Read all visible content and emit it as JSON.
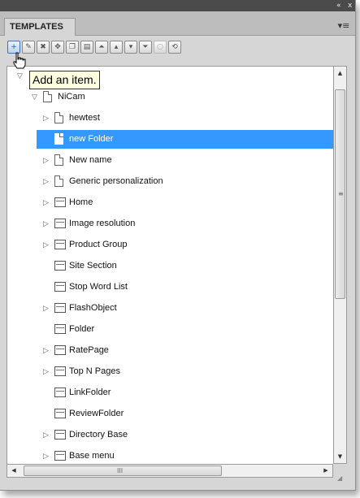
{
  "panel": {
    "tab_label": "TEMPLATES",
    "collapse_glyph": "«",
    "close_glyph": "x",
    "menu_glyph": "▾≡"
  },
  "toolbar": {
    "buttons": [
      {
        "name": "add-item-button",
        "icon": "add-icon",
        "glyph": "+"
      },
      {
        "name": "edit-item-button",
        "icon": "edit-icon",
        "glyph": "✎"
      },
      {
        "name": "delete-item-button",
        "icon": "delete-icon",
        "glyph": "✖"
      },
      {
        "name": "move-item-button",
        "icon": "move-icon",
        "glyph": "✥"
      },
      {
        "name": "copy-item-button",
        "icon": "copy-icon",
        "glyph": "❐"
      },
      {
        "name": "paste-item-button",
        "icon": "paste-icon",
        "glyph": "▤"
      },
      {
        "name": "move-top-button",
        "icon": "double-up-icon",
        "glyph": "⏶"
      },
      {
        "name": "move-up-button",
        "icon": "up-icon",
        "glyph": "▴"
      },
      {
        "name": "move-down-button",
        "icon": "down-icon",
        "glyph": "▾"
      },
      {
        "name": "move-bottom-button",
        "icon": "double-down-icon",
        "glyph": "⏷"
      },
      {
        "name": "disabled-button",
        "icon": "circle-icon",
        "glyph": "○"
      },
      {
        "name": "refresh-button",
        "icon": "refresh-icon",
        "glyph": "⟲"
      }
    ]
  },
  "tooltip": {
    "text": "Add an item."
  },
  "tree": {
    "items": [
      {
        "label": "NiCam",
        "expander": "expanded",
        "icon": "document-icon"
      },
      {
        "label": "hewtest",
        "expander": "collapsed",
        "icon": "document-icon"
      },
      {
        "label": "new Folder",
        "expander": "none",
        "icon": "document-icon",
        "selected": true
      },
      {
        "label": "New name",
        "expander": "collapsed",
        "icon": "document-icon"
      },
      {
        "label": "Generic personalization",
        "expander": "collapsed",
        "icon": "document-icon"
      },
      {
        "label": "Home",
        "expander": "collapsed",
        "icon": "template-icon"
      },
      {
        "label": "Image resolution",
        "expander": "collapsed",
        "icon": "template-icon"
      },
      {
        "label": "Product Group",
        "expander": "collapsed",
        "icon": "template-icon"
      },
      {
        "label": "Site Section",
        "expander": "none",
        "icon": "template-icon"
      },
      {
        "label": "Stop Word List",
        "expander": "none",
        "icon": "template-icon"
      },
      {
        "label": "FlashObject",
        "expander": "collapsed",
        "icon": "template-icon"
      },
      {
        "label": "Folder",
        "expander": "none",
        "icon": "template-icon"
      },
      {
        "label": "RatePage",
        "expander": "collapsed",
        "icon": "template-icon"
      },
      {
        "label": "Top N Pages",
        "expander": "collapsed",
        "icon": "template-icon"
      },
      {
        "label": "LinkFolder",
        "expander": "none",
        "icon": "template-icon"
      },
      {
        "label": "ReviewFolder",
        "expander": "none",
        "icon": "template-icon"
      },
      {
        "label": "Directory Base",
        "expander": "collapsed",
        "icon": "template-icon"
      },
      {
        "label": "Base menu",
        "expander": "collapsed",
        "icon": "template-icon"
      }
    ]
  },
  "scrollbars": {
    "vertical": {
      "up_glyph": "▲",
      "down_glyph": "▼",
      "grip_glyph": "≡"
    },
    "horizontal": {
      "left_glyph": "◀",
      "right_glyph": "▶",
      "grip_glyph": "III"
    },
    "resize_glyph": "◢"
  },
  "colors": {
    "selection": "#3399ff",
    "tooltip_bg": "#ffffe1",
    "panel_bg": "#d6d6d6"
  }
}
